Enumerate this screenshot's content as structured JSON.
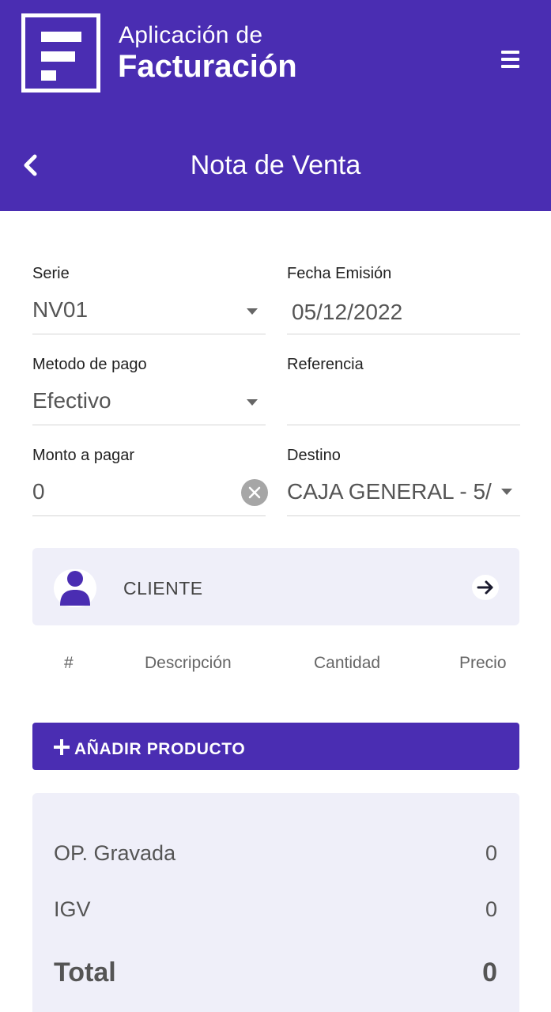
{
  "header": {
    "app_title_line1": "Aplicación de",
    "app_title_line2": "Facturación",
    "page_title": "Nota de Venta",
    "brand_color": "#4a2db2"
  },
  "form": {
    "serie": {
      "label": "Serie",
      "value": "NV01"
    },
    "fecha_emision": {
      "label": "Fecha Emisión",
      "value": "05/12/2022"
    },
    "metodo_pago": {
      "label": "Metodo de pago",
      "value": "Efectivo"
    },
    "referencia": {
      "label": "Referencia",
      "value": ""
    },
    "monto_pagar": {
      "label": "Monto a pagar",
      "value": "0"
    },
    "destino": {
      "label": "Destino",
      "value": "CAJA GENERAL - 5/"
    }
  },
  "client": {
    "label": "CLIENTE"
  },
  "table": {
    "columns": [
      "#",
      "Descripción",
      "Cantidad",
      "Precio"
    ]
  },
  "add_product_label": "AÑADIR PRODUCTO",
  "totals": {
    "op_gravada": {
      "label": "OP. Gravada",
      "value": "0"
    },
    "igv": {
      "label": "IGV",
      "value": "0"
    },
    "total": {
      "label": "Total",
      "value": "0"
    }
  },
  "icons": [
    "app-logo-icon",
    "menu-icon",
    "back-arrow-icon",
    "dropdown-caret-icon",
    "clear-icon",
    "user-icon",
    "arrow-right-icon",
    "plus-icon"
  ]
}
